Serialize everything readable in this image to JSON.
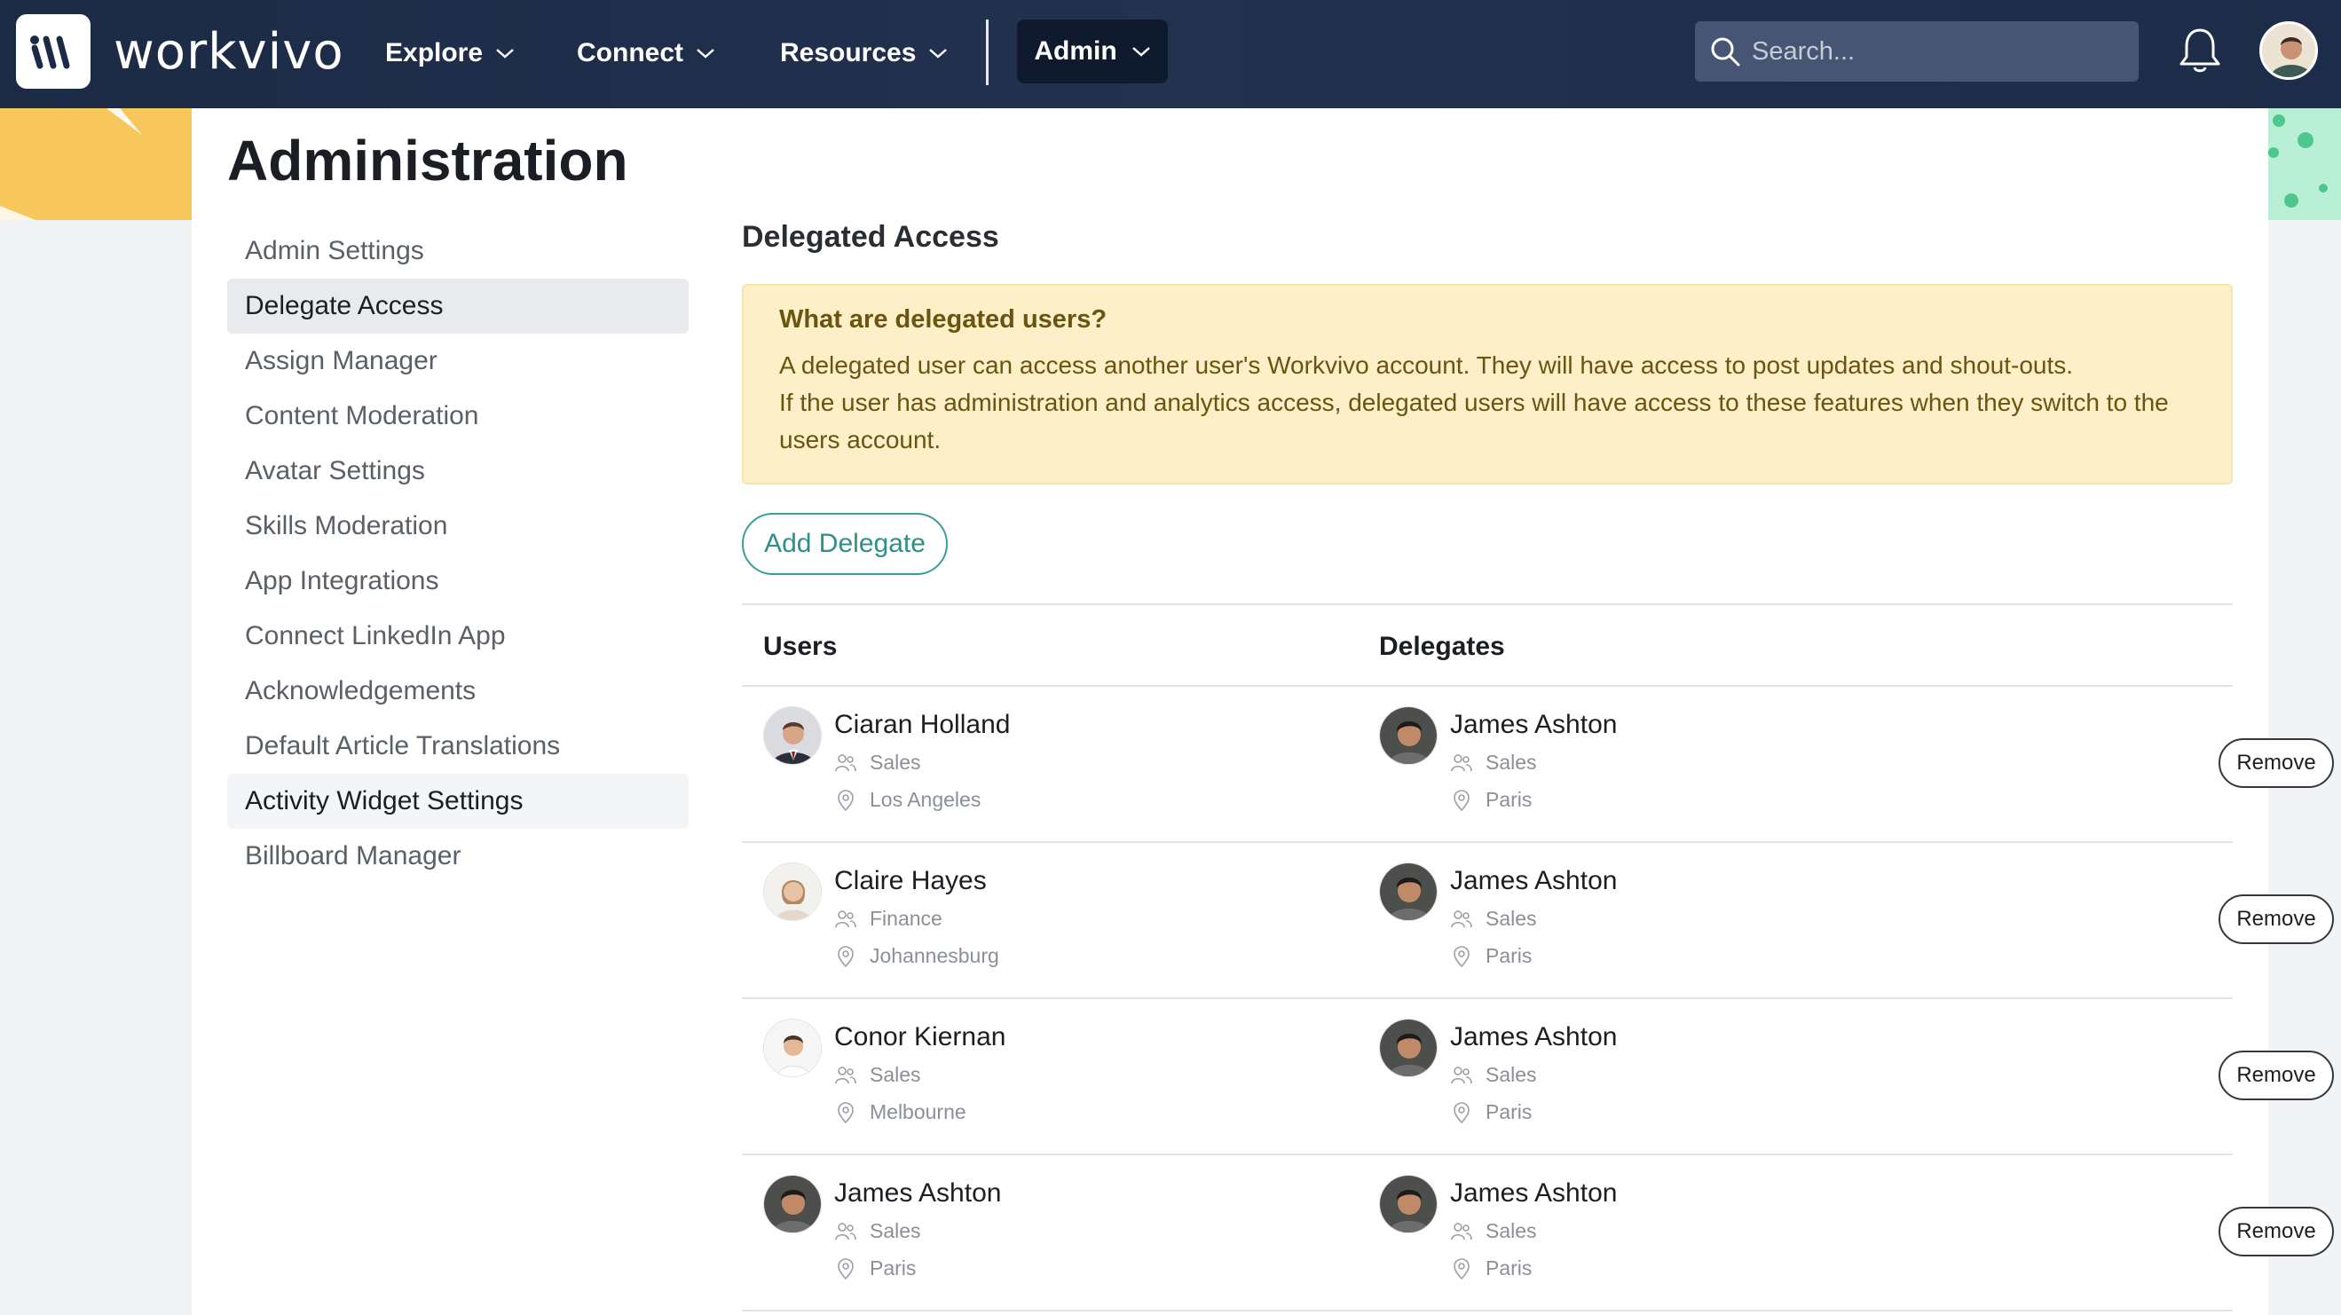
{
  "topbar": {
    "brand": "workvivo",
    "nav": [
      {
        "label": "Explore"
      },
      {
        "label": "Connect"
      },
      {
        "label": "Resources"
      }
    ],
    "admin_label": "Admin",
    "search_placeholder": "Search...",
    "icons": [
      "logo-icon",
      "chevron-down-icon",
      "search-icon",
      "bell-icon"
    ]
  },
  "page": {
    "title": "Administration"
  },
  "sidebar": {
    "items": [
      {
        "label": "Admin Settings"
      },
      {
        "label": "Delegate Access",
        "active": true
      },
      {
        "label": "Assign Manager"
      },
      {
        "label": "Content Moderation"
      },
      {
        "label": "Avatar Settings"
      },
      {
        "label": "Skills Moderation"
      },
      {
        "label": "App Integrations"
      },
      {
        "label": "Connect LinkedIn App"
      },
      {
        "label": "Acknowledgements"
      },
      {
        "label": "Default Article Translations"
      },
      {
        "label": "Activity Widget Settings",
        "hovered": true
      },
      {
        "label": "Billboard Manager"
      }
    ]
  },
  "content": {
    "section_title": "Delegated Access",
    "info": {
      "question": "What are delegated users?",
      "line1": "A delegated user can access another user's Workvivo account. They will have access to post updates and shout-outs.",
      "line2": "If the user has administration and analytics access, delegated users will have access to these features when they switch to the users account."
    },
    "add_button": "Add Delegate",
    "table": {
      "col_users": "Users",
      "col_delegates": "Delegates",
      "remove_label": "Remove",
      "rows": [
        {
          "user": {
            "name": "Ciaran Holland",
            "dept": "Sales",
            "location": "Los Angeles"
          },
          "delegate": {
            "name": "James Ashton",
            "dept": "Sales",
            "location": "Paris"
          }
        },
        {
          "user": {
            "name": "Claire Hayes",
            "dept": "Finance",
            "location": "Johannesburg"
          },
          "delegate": {
            "name": "James Ashton",
            "dept": "Sales",
            "location": "Paris"
          }
        },
        {
          "user": {
            "name": "Conor Kiernan",
            "dept": "Sales",
            "location": "Melbourne"
          },
          "delegate": {
            "name": "James Ashton",
            "dept": "Sales",
            "location": "Paris"
          }
        },
        {
          "user": {
            "name": "James Ashton",
            "dept": "Sales",
            "location": "Paris"
          },
          "delegate": {
            "name": "James Ashton",
            "dept": "Sales",
            "location": "Paris"
          }
        }
      ]
    }
  },
  "colors": {
    "topbar": "#1b2a45",
    "accent_teal": "#3a9d96",
    "info_bg": "#fdf0c8",
    "info_text": "#6a5410",
    "deco_yellow": "#f7c75b",
    "deco_mint": "#b9efd7"
  }
}
